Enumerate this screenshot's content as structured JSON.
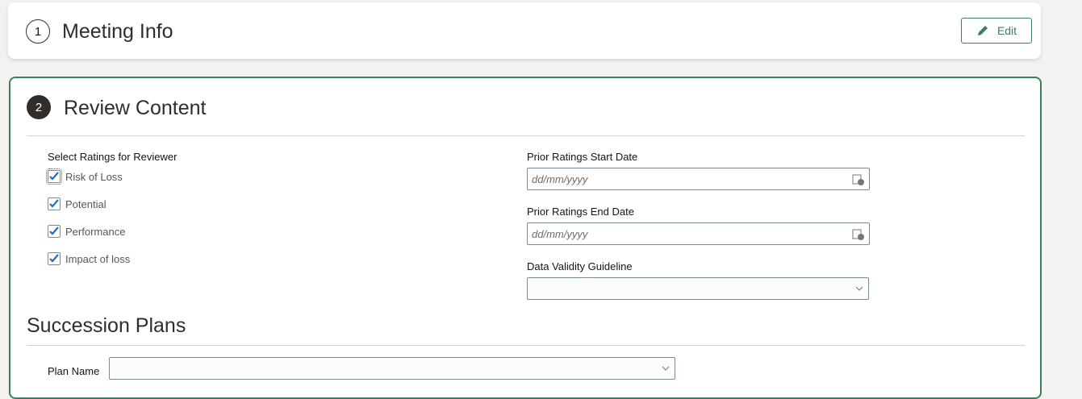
{
  "step1": {
    "number": "1",
    "title": "Meeting Info",
    "edit_label": "Edit"
  },
  "step2": {
    "number": "2",
    "title": "Review Content"
  },
  "ratings": {
    "label": "Select Ratings for Reviewer",
    "items": [
      {
        "label": "Risk of Loss",
        "checked": true
      },
      {
        "label": "Potential",
        "checked": true
      },
      {
        "label": "Performance",
        "checked": true
      },
      {
        "label": "Impact of loss",
        "checked": true
      }
    ]
  },
  "prior_start": {
    "label": "Prior Ratings Start Date",
    "placeholder": "dd/mm/yyyy"
  },
  "prior_end": {
    "label": "Prior Ratings End Date",
    "placeholder": "dd/mm/yyyy"
  },
  "guideline": {
    "label": "Data Validity Guideline",
    "value": ""
  },
  "succession": {
    "title": "Succession Plans",
    "plan_name_label": "Plan Name",
    "plan_name_value": ""
  },
  "colors": {
    "accent": "#3d7f5a",
    "check": "#1b6ec2"
  }
}
